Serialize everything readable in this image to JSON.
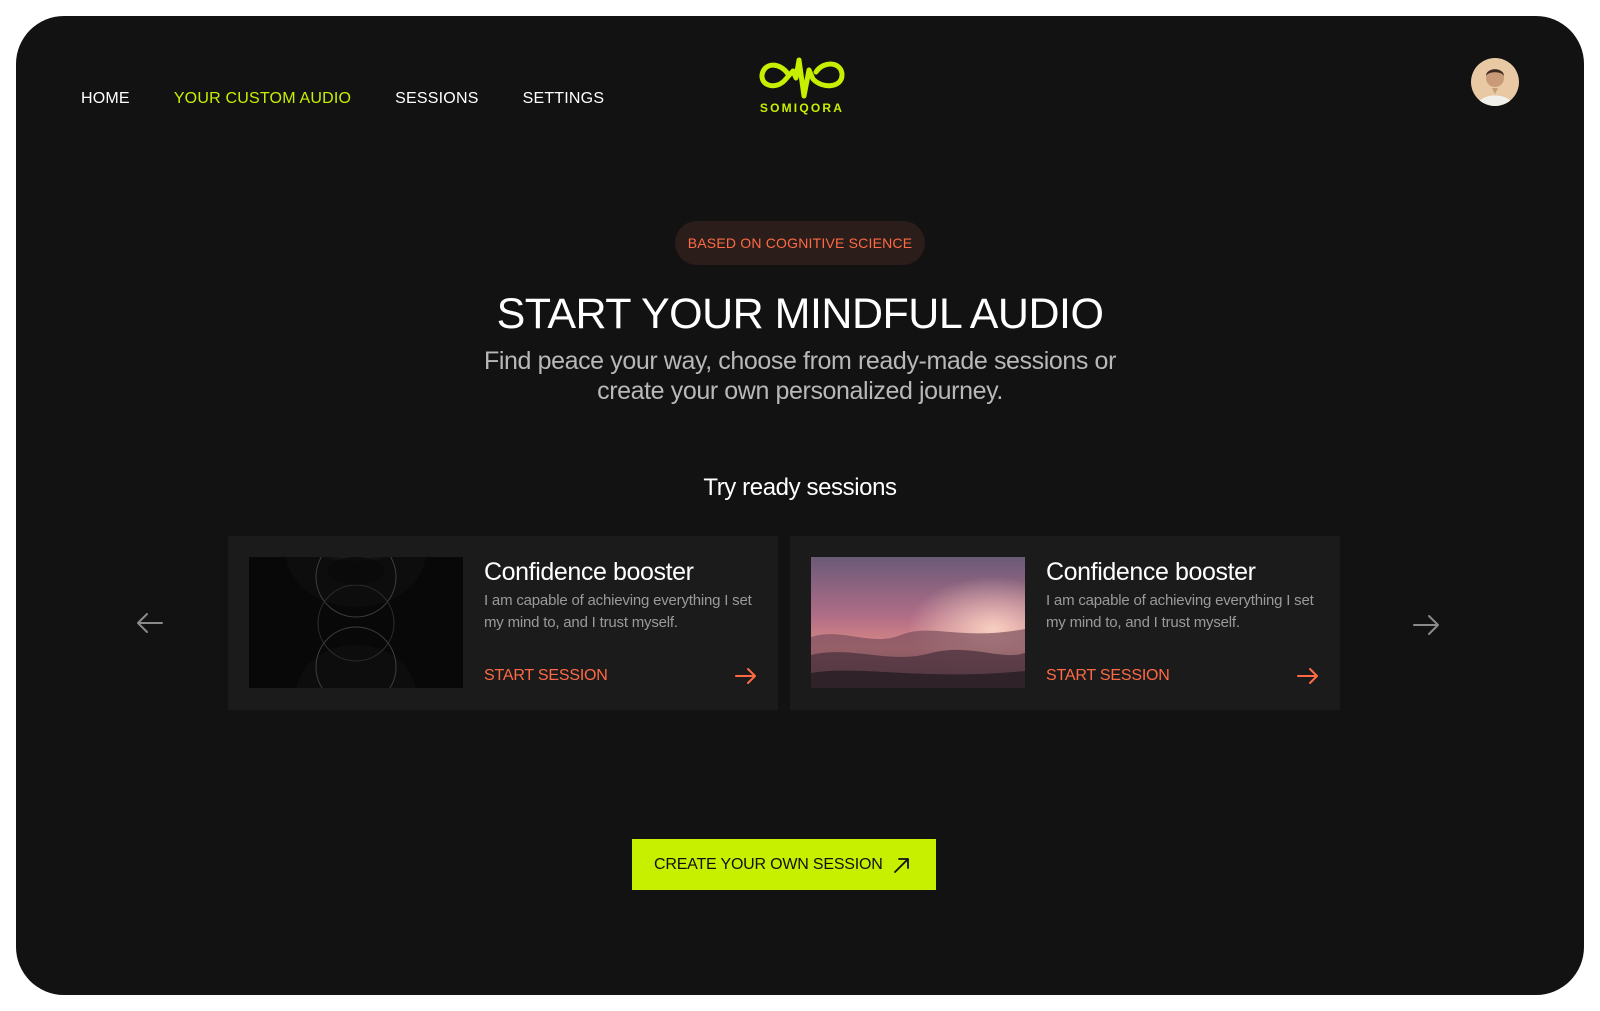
{
  "brand": {
    "name": "SOMIQORA",
    "accent": "#c7f000",
    "secondary": "#ff6a45",
    "background": "#121212",
    "card_background": "#1b1b1b"
  },
  "nav": {
    "items": [
      {
        "label": "HOME",
        "active": false
      },
      {
        "label": "YOUR CUSTOM AUDIO",
        "active": true
      },
      {
        "label": "SESSIONS",
        "active": false
      },
      {
        "label": "SETTINGS",
        "active": false
      }
    ]
  },
  "user": {
    "avatar_icon": "user-avatar"
  },
  "hero": {
    "badge": "BASED ON COGNITIVE SCIENCE",
    "title": "START YOUR MINDFUL AUDIO",
    "subtitle": "Find peace your way, choose from ready-made sessions or create your own personalized journey."
  },
  "sessions": {
    "heading": "Try ready sessions",
    "prev_icon": "arrow-left-icon",
    "next_icon": "arrow-right-icon",
    "cards": [
      {
        "title": "Confidence booster",
        "description": "I am capable of achieving everything I set my mind to, and I trust myself.",
        "action": "START SESSION",
        "image": "abstract-glowing-orbs"
      },
      {
        "title": "Confidence booster",
        "description": "I am capable of achieving everything I set my mind to, and I trust myself.",
        "action": "START SESSION",
        "image": "pink-sunset-clouds"
      }
    ]
  },
  "cta": {
    "label": "CREATE YOUR OWN SESSION",
    "icon": "arrow-up-right-icon"
  }
}
